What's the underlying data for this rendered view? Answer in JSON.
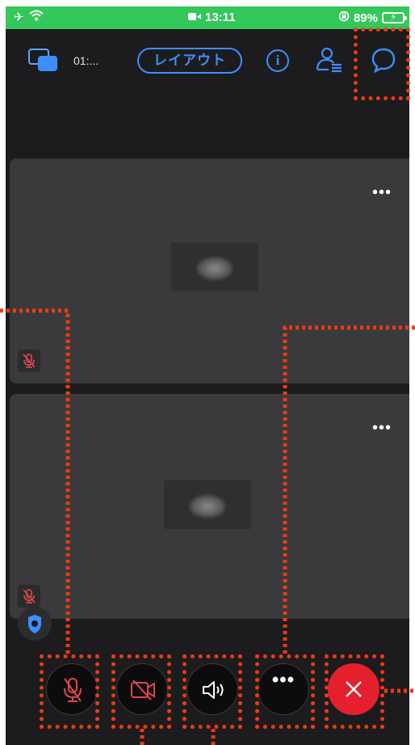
{
  "status_bar": {
    "time": "13:11",
    "battery": "89%"
  },
  "toolbar": {
    "timer": "01:...",
    "layout_label": "レイアウト",
    "info_label": "i"
  },
  "tiles": [
    {
      "more_label": "•••"
    },
    {
      "more_label": "•••"
    }
  ],
  "controls": {
    "more_label": "•••",
    "colors": {
      "end_call": "#e5202e",
      "muted_icon": "#e0484c",
      "accent": "#3d8fff",
      "status_bar": "#34c759",
      "annotation": "#f03a12"
    }
  },
  "icons": {
    "airplane": "airplane-icon",
    "wifi": "wifi-icon",
    "video_record": "video-camera-icon",
    "orientation_lock": "orientation-lock-icon",
    "share_screen": "share-screen-icon",
    "participants": "participants-icon",
    "chat": "chat-bubble-icon",
    "mic_muted": "mic-muted-icon",
    "video_off": "video-off-icon",
    "speaker": "speaker-icon",
    "end_call": "close-icon",
    "shield": "shield-icon"
  }
}
